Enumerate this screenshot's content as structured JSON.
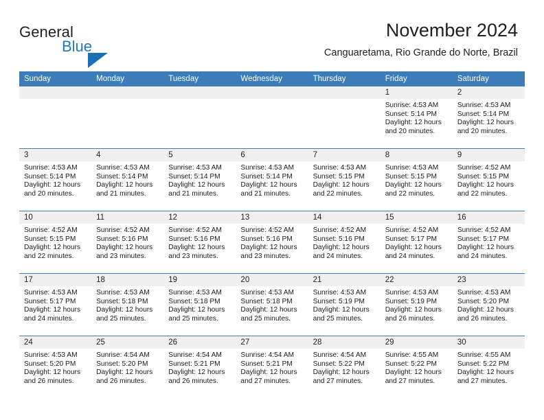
{
  "brand": {
    "name_top": "General",
    "name_bottom": "Blue",
    "accent_color": "#1a6fb5"
  },
  "header": {
    "title": "November 2024",
    "subtitle": "Canguaretama, Rio Grande do Norte, Brazil"
  },
  "calendar": {
    "header_bg": "#3b7cb9",
    "day_band_bg": "#f0f0f0",
    "weekdays": [
      "Sunday",
      "Monday",
      "Tuesday",
      "Wednesday",
      "Thursday",
      "Friday",
      "Saturday"
    ],
    "weeks": [
      [
        {
          "day": "",
          "empty": true
        },
        {
          "day": "",
          "empty": true
        },
        {
          "day": "",
          "empty": true
        },
        {
          "day": "",
          "empty": true
        },
        {
          "day": "",
          "empty": true
        },
        {
          "day": "1",
          "sunrise": "Sunrise: 4:53 AM",
          "sunset": "Sunset: 5:14 PM",
          "daylight": "Daylight: 12 hours and 20 minutes."
        },
        {
          "day": "2",
          "sunrise": "Sunrise: 4:53 AM",
          "sunset": "Sunset: 5:14 PM",
          "daylight": "Daylight: 12 hours and 20 minutes."
        }
      ],
      [
        {
          "day": "3",
          "sunrise": "Sunrise: 4:53 AM",
          "sunset": "Sunset: 5:14 PM",
          "daylight": "Daylight: 12 hours and 20 minutes."
        },
        {
          "day": "4",
          "sunrise": "Sunrise: 4:53 AM",
          "sunset": "Sunset: 5:14 PM",
          "daylight": "Daylight: 12 hours and 21 minutes."
        },
        {
          "day": "5",
          "sunrise": "Sunrise: 4:53 AM",
          "sunset": "Sunset: 5:14 PM",
          "daylight": "Daylight: 12 hours and 21 minutes."
        },
        {
          "day": "6",
          "sunrise": "Sunrise: 4:53 AM",
          "sunset": "Sunset: 5:14 PM",
          "daylight": "Daylight: 12 hours and 21 minutes."
        },
        {
          "day": "7",
          "sunrise": "Sunrise: 4:53 AM",
          "sunset": "Sunset: 5:15 PM",
          "daylight": "Daylight: 12 hours and 22 minutes."
        },
        {
          "day": "8",
          "sunrise": "Sunrise: 4:53 AM",
          "sunset": "Sunset: 5:15 PM",
          "daylight": "Daylight: 12 hours and 22 minutes."
        },
        {
          "day": "9",
          "sunrise": "Sunrise: 4:52 AM",
          "sunset": "Sunset: 5:15 PM",
          "daylight": "Daylight: 12 hours and 22 minutes."
        }
      ],
      [
        {
          "day": "10",
          "sunrise": "Sunrise: 4:52 AM",
          "sunset": "Sunset: 5:15 PM",
          "daylight": "Daylight: 12 hours and 22 minutes."
        },
        {
          "day": "11",
          "sunrise": "Sunrise: 4:52 AM",
          "sunset": "Sunset: 5:16 PM",
          "daylight": "Daylight: 12 hours and 23 minutes."
        },
        {
          "day": "12",
          "sunrise": "Sunrise: 4:52 AM",
          "sunset": "Sunset: 5:16 PM",
          "daylight": "Daylight: 12 hours and 23 minutes."
        },
        {
          "day": "13",
          "sunrise": "Sunrise: 4:52 AM",
          "sunset": "Sunset: 5:16 PM",
          "daylight": "Daylight: 12 hours and 23 minutes."
        },
        {
          "day": "14",
          "sunrise": "Sunrise: 4:52 AM",
          "sunset": "Sunset: 5:16 PM",
          "daylight": "Daylight: 12 hours and 24 minutes."
        },
        {
          "day": "15",
          "sunrise": "Sunrise: 4:52 AM",
          "sunset": "Sunset: 5:17 PM",
          "daylight": "Daylight: 12 hours and 24 minutes."
        },
        {
          "day": "16",
          "sunrise": "Sunrise: 4:52 AM",
          "sunset": "Sunset: 5:17 PM",
          "daylight": "Daylight: 12 hours and 24 minutes."
        }
      ],
      [
        {
          "day": "17",
          "sunrise": "Sunrise: 4:53 AM",
          "sunset": "Sunset: 5:17 PM",
          "daylight": "Daylight: 12 hours and 24 minutes."
        },
        {
          "day": "18",
          "sunrise": "Sunrise: 4:53 AM",
          "sunset": "Sunset: 5:18 PM",
          "daylight": "Daylight: 12 hours and 25 minutes."
        },
        {
          "day": "19",
          "sunrise": "Sunrise: 4:53 AM",
          "sunset": "Sunset: 5:18 PM",
          "daylight": "Daylight: 12 hours and 25 minutes."
        },
        {
          "day": "20",
          "sunrise": "Sunrise: 4:53 AM",
          "sunset": "Sunset: 5:18 PM",
          "daylight": "Daylight: 12 hours and 25 minutes."
        },
        {
          "day": "21",
          "sunrise": "Sunrise: 4:53 AM",
          "sunset": "Sunset: 5:19 PM",
          "daylight": "Daylight: 12 hours and 25 minutes."
        },
        {
          "day": "22",
          "sunrise": "Sunrise: 4:53 AM",
          "sunset": "Sunset: 5:19 PM",
          "daylight": "Daylight: 12 hours and 26 minutes."
        },
        {
          "day": "23",
          "sunrise": "Sunrise: 4:53 AM",
          "sunset": "Sunset: 5:20 PM",
          "daylight": "Daylight: 12 hours and 26 minutes."
        }
      ],
      [
        {
          "day": "24",
          "sunrise": "Sunrise: 4:53 AM",
          "sunset": "Sunset: 5:20 PM",
          "daylight": "Daylight: 12 hours and 26 minutes."
        },
        {
          "day": "25",
          "sunrise": "Sunrise: 4:54 AM",
          "sunset": "Sunset: 5:20 PM",
          "daylight": "Daylight: 12 hours and 26 minutes."
        },
        {
          "day": "26",
          "sunrise": "Sunrise: 4:54 AM",
          "sunset": "Sunset: 5:21 PM",
          "daylight": "Daylight: 12 hours and 26 minutes."
        },
        {
          "day": "27",
          "sunrise": "Sunrise: 4:54 AM",
          "sunset": "Sunset: 5:21 PM",
          "daylight": "Daylight: 12 hours and 27 minutes."
        },
        {
          "day": "28",
          "sunrise": "Sunrise: 4:54 AM",
          "sunset": "Sunset: 5:22 PM",
          "daylight": "Daylight: 12 hours and 27 minutes."
        },
        {
          "day": "29",
          "sunrise": "Sunrise: 4:55 AM",
          "sunset": "Sunset: 5:22 PM",
          "daylight": "Daylight: 12 hours and 27 minutes."
        },
        {
          "day": "30",
          "sunrise": "Sunrise: 4:55 AM",
          "sunset": "Sunset: 5:22 PM",
          "daylight": "Daylight: 12 hours and 27 minutes."
        }
      ]
    ]
  }
}
